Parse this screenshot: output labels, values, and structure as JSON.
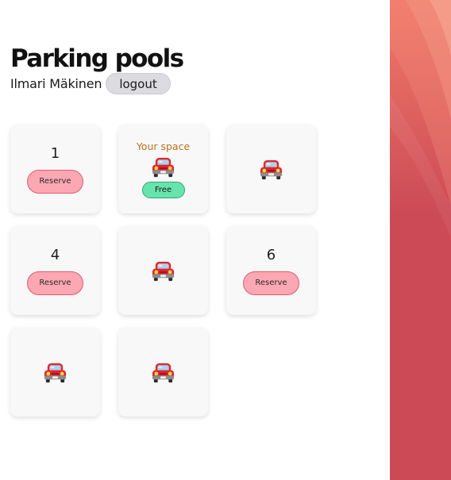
{
  "header": {
    "title": "Parking pools",
    "user_name": "Ilmari Mäkinen",
    "logout_label": "logout"
  },
  "spaces": {
    "s1": {
      "number": "1",
      "status": "available",
      "action_label": "Reserve"
    },
    "s2": {
      "status": "yours",
      "label": "Your space",
      "icon": "car-icon",
      "action_label": "Free"
    },
    "s3": {
      "status": "occupied",
      "icon": "car-icon"
    },
    "s4": {
      "number": "4",
      "status": "available",
      "action_label": "Reserve"
    },
    "s5": {
      "status": "occupied",
      "icon": "car-icon"
    },
    "s6": {
      "number": "6",
      "status": "available",
      "action_label": "Reserve"
    },
    "s7": {
      "status": "occupied",
      "icon": "car-icon"
    },
    "s8": {
      "status": "occupied",
      "icon": "car-icon"
    }
  },
  "colors": {
    "reserve_fill": "#fba8b3",
    "free_fill": "#67e4ac",
    "your_space_text": "#b9701f",
    "side_panel_top": "#f27a69",
    "side_panel_bottom": "#cb4a56"
  }
}
